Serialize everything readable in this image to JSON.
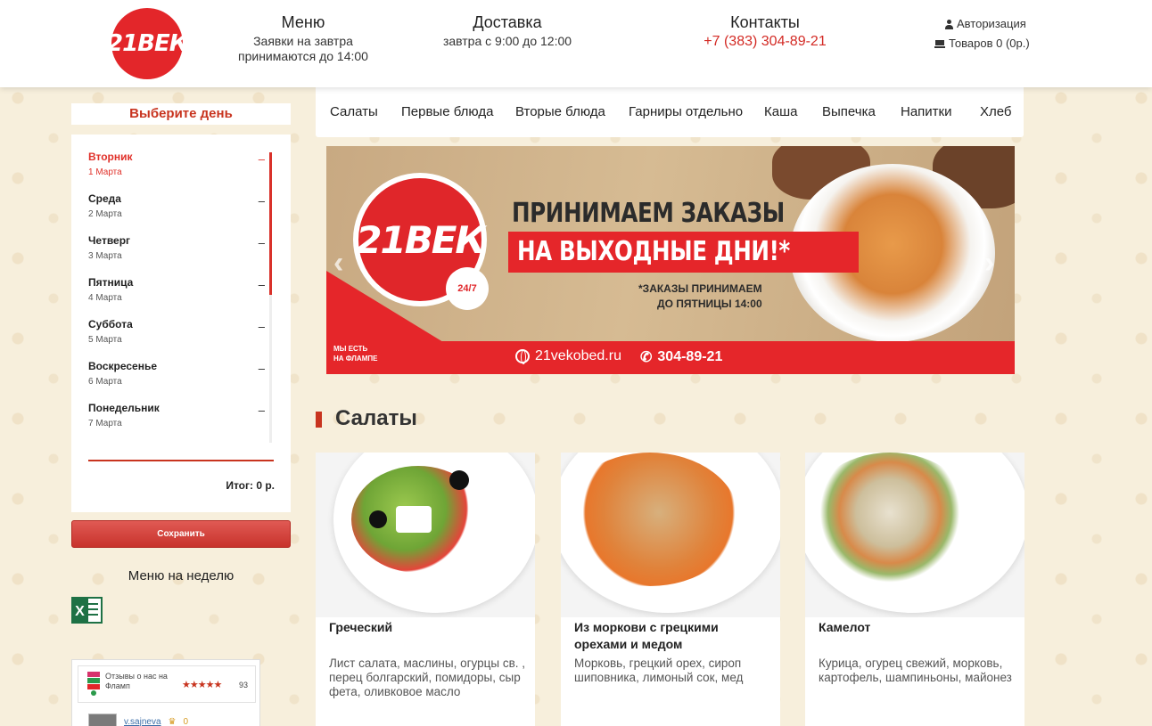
{
  "header": {
    "logo_text": "21ВЕК",
    "menu_title": "Меню",
    "menu_sub_1": "Заявки на завтра",
    "menu_sub_2": "принимаются до 14:00",
    "delivery_title": "Доставка",
    "delivery_sub": "завтра с 9:00 до 12:00",
    "contacts_title": "Контакты",
    "contacts_phone": "+7 (383) 304-89-21",
    "auth_label": "Авторизация",
    "cart_label": "Товаров 0 (0р.)"
  },
  "sidebar": {
    "choose_day": "Выберите день",
    "days": [
      {
        "name": "Вторник",
        "date": "1 Марта",
        "active": true
      },
      {
        "name": "Среда",
        "date": "2 Марта"
      },
      {
        "name": "Четверг",
        "date": "3 Марта"
      },
      {
        "name": "Пятница",
        "date": "4 Марта"
      },
      {
        "name": "Суббота",
        "date": "5 Марта"
      },
      {
        "name": "Воскресенье",
        "date": "6 Марта"
      },
      {
        "name": "Понедельник",
        "date": "7 Марта"
      }
    ],
    "dash": "–",
    "total": "Итог: 0 р.",
    "save_label": "Сохранить",
    "week_menu": "Меню на неделю",
    "excel_letter": "X",
    "flamp": {
      "title": "Отзывы о нас на Фламп",
      "stars": "★★★★★",
      "count": "93",
      "user": "v.sajneva",
      "crown": "♛",
      "user_score": "0"
    }
  },
  "nav": {
    "items": [
      "Салаты",
      "Первые блюда",
      "Вторые блюда",
      "Гарниры отдельно",
      "Каша",
      "Выпечка",
      "Напитки",
      "Хлеб"
    ]
  },
  "banner": {
    "logo_text": "21ВЕК",
    "badge": "24/7",
    "line1": "ПРИНИМАЕМ ЗАКАЗЫ",
    "line2": "НА ВЫХОДНЫЕ ДНИ!*",
    "note1": "*ЗАКАЗЫ ПРИНИМАЕМ",
    "note2": "ДО ПЯТНИЦЫ 14:00",
    "flamp1": "МЫ ЕСТЬ",
    "flamp2": "НА ФЛАМПЕ",
    "site": "21vekobed.ru",
    "phone": "304-89-21",
    "arrow_left": "‹",
    "arrow_right": "›"
  },
  "section": {
    "title": "Салаты"
  },
  "products": [
    {
      "name": "Греческий",
      "desc": "Лист салата, маслины, огурцы св. , перец болгарский, помидоры, сыр фета, оливковое масло"
    },
    {
      "name": "Из моркови с грецкими орехами и медом",
      "desc": "Морковь, грецкий орех, сироп шиповника, лимоный сок, мед"
    },
    {
      "name": "Камелот",
      "desc": "Курица, огурец свежий, морковь, картофель, шампиньоны, майонез"
    }
  ],
  "colors": {
    "brand_red": "#e3262a",
    "accent": "#c8341f",
    "background": "#f7efdc"
  }
}
